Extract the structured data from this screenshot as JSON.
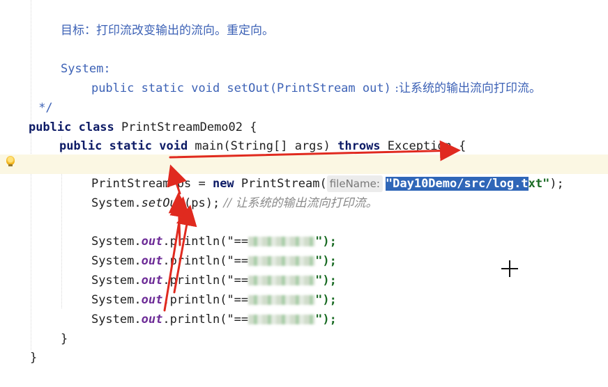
{
  "code": {
    "comment_goal": "目标：打印流改变输出的流向。重定向。",
    "comment_system": "System:",
    "comment_method_sig": "public static void setOut(PrintStream out)",
    "comment_method_desc": " :让系统的输出流向打印流。",
    "comment_end": " */",
    "class_kw": "public class",
    "class_name": " PrintStreamDemo02 {",
    "main_kw1": "public static void",
    "main_rest": " main(String[] args) ",
    "main_throws": "throws",
    "main_exc": " Exception {",
    "ps_decl_pre": "PrintStream ps = ",
    "ps_new": "new",
    "ps_ctor": " PrintStream(",
    "param_hint": "fileName:",
    "file_str_sel": "\"Day10Demo/src/log.t",
    "file_str_rest": "xt\"",
    "ps_tail": ");",
    "setout_pre": "System.",
    "setout_method": "setOut",
    "setout_args": "(ps);",
    "setout_comment": " // 让系统的输出流向打印流。",
    "println_prefix": "System.",
    "println_field": "out",
    "println_call": ".println(\"==",
    "println_suffix": "\");",
    "close_brace_inner": "}",
    "close_brace_outer": "}"
  }
}
